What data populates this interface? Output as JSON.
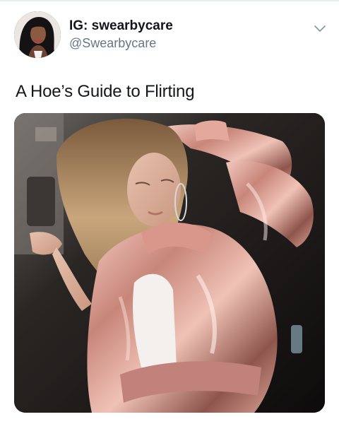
{
  "tweet": {
    "author": {
      "display_name": "IG: swearbycare",
      "handle": "@Swearbycare",
      "avatar_icon": "profile-photo"
    },
    "text": "A Hoe’s Guide to Flirting",
    "menu_icon": "chevron-down-icon",
    "media": {
      "kind": "photo",
      "subject": "woman in rose satin bomber jacket"
    }
  },
  "colors": {
    "primary_text": "#14171a",
    "secondary_text": "#657786",
    "divider": "#e6ecf0",
    "chevron": "#8899a6",
    "satin_rose": "#c58f86"
  }
}
